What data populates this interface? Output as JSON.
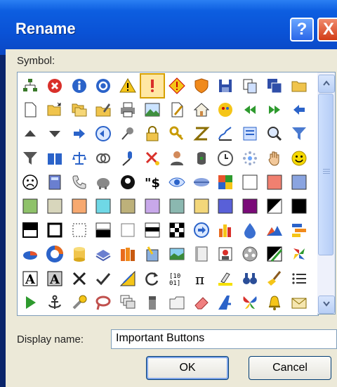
{
  "dialog": {
    "title": "Rename",
    "help_glyph": "?",
    "close_glyph": "X",
    "symbol_label": "Symbol:",
    "display_name_label": "Display name:",
    "display_name_value": "Important Buttons",
    "ok_label": "OK",
    "cancel_label": "Cancel",
    "selected_index": 5
  },
  "symbols": [
    "org-chart-icon",
    "delete-icon",
    "info-icon",
    "circle-target-icon",
    "warning-icon",
    "exclamation-icon",
    "warning-diamond-icon",
    "shield-icon",
    "save-icon",
    "copy-icon",
    "save-all-icon",
    "folder-icon",
    "new-document-icon",
    "open-folder-icon",
    "copy-folder-icon",
    "edit-folder-icon",
    "print-icon",
    "picture-icon",
    "edit-page-icon",
    "home-icon",
    "smiley-ball-icon",
    "back-double-arrow-icon",
    "forward-double-arrow-icon",
    "left-arrow-icon",
    "up-triangle-icon",
    "down-triangle-icon",
    "right-arrow-icon",
    "back-circle-icon",
    "pin-icon",
    "lock-icon",
    "key-icon",
    "sort-icon",
    "signature-icon",
    "form-icon",
    "zoom-icon",
    "filter-icon",
    "filter-clear-icon",
    "book-icon",
    "scales-icon",
    "rings-icon",
    "microphone-icon",
    "cut-icon",
    "user-icon",
    "db-user-icon",
    "clock-icon",
    "sparkle-icon",
    "hand-icon",
    "smiley-icon",
    "sad-face-icon",
    "calculator-icon",
    "phone-icon",
    "piggy-bank-icon",
    "eight-ball-icon",
    "currency-icon",
    "eye-icon",
    "lips-icon",
    "color-grid-icon",
    "white-swatch-icon",
    "salmon-swatch-icon",
    "blue-swatch-icon",
    "green-swatch-icon",
    "beige-swatch-icon",
    "orange-swatch-icon",
    "cyan-swatch-icon",
    "olive-swatch-icon",
    "lavender-swatch-icon",
    "teal-swatch-icon",
    "yellow-swatch-icon",
    "indigo-swatch-icon",
    "purple-swatch-icon",
    "contrast-swatch-icon",
    "black-swatch-icon",
    "half-black-icon",
    "outline-box-icon",
    "dotted-box-icon",
    "half-gray-icon",
    "empty-box-icon",
    "stripe-box-icon",
    "checker-icon",
    "forward-circle-icon",
    "bar-chart-icon",
    "drop-icon",
    "mountain-icon",
    "gantt-icon",
    "pie-chart-icon",
    "donut-icon",
    "cylinder-icon",
    "stack-icon",
    "books-icon",
    "document-pen-icon",
    "landscape-icon",
    "blank-page-icon",
    "portrait-icon",
    "film-icon",
    "contrast-slash-icon",
    "pinwheel-icon",
    "font-box-icon",
    "font-dark-box-icon",
    "x-mark-icon",
    "checkmark-icon",
    "ruler-icon",
    "refresh-icon",
    "binary-icon",
    "pi-icon",
    "highlight-icon",
    "binoculars-icon",
    "broom-icon",
    "list-icon",
    "play-icon",
    "anchor-icon",
    "tools-icon",
    "lasso-icon",
    "windows-stack-icon",
    "stapler-icon",
    "tab-icon",
    "eraser-icon",
    "slant-a-icon",
    "butterfly-icon",
    "bell-icon",
    "envelope-icon"
  ]
}
